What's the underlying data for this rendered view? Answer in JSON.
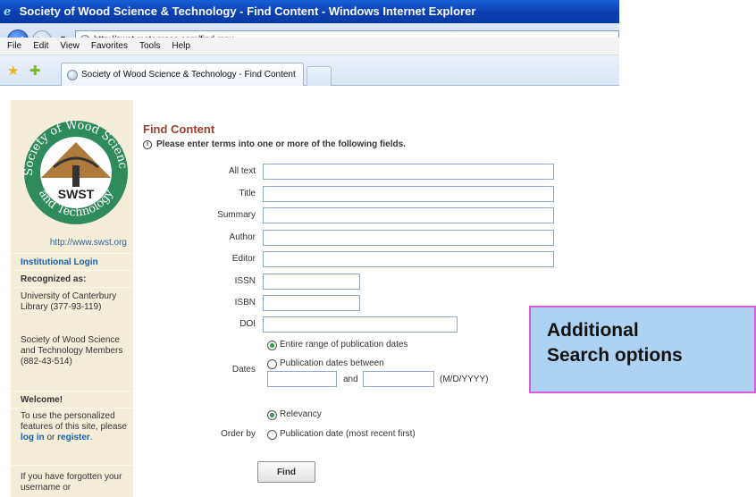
{
  "browser": {
    "window_title": "Society of Wood Science & Technology - Find Content - Windows Internet Explorer",
    "address": "http://swst.metapress.com/find.mpx",
    "menu": [
      "File",
      "Edit",
      "View",
      "Favorites",
      "Tools",
      "Help"
    ],
    "tab_label": "Society of Wood Science & Technology - Find Content",
    "back_glyph": "◀",
    "forward_glyph": "▶",
    "dropdown_glyph": "▼"
  },
  "sidebar": {
    "logo_text": "SWST",
    "logo_ring_top": "Society of Wood Science",
    "logo_ring_bottom": "and Technology",
    "site_url": "http://www.swst.org",
    "login_link": "Institutional Login",
    "recognized_head": "Recognized as:",
    "recognized_1": "University of Canterbury Library (377-93-119)",
    "recognized_2": "Society of Wood Science and Technology Members (882-43-514)",
    "welcome_head": "Welcome!",
    "welcome_pre": "To use the personalized features of this site, please",
    "log_in_link": "log in",
    "or_text": "or",
    "register_link": "register",
    "welcome_end": ".",
    "forgot_text": "If you have forgotten your username or"
  },
  "main": {
    "title": "Find Content",
    "info_icon": "i",
    "info_text": "Please enter terms into one or more of the following fields.",
    "fields": {
      "all_text": "All text",
      "title": "Title",
      "summary": "Summary",
      "author": "Author",
      "editor": "Editor",
      "issn": "ISSN",
      "isbn": "ISBN",
      "doi": "DOI"
    },
    "dates_label": "Dates",
    "dates_option_all": "Entire range of publication dates",
    "dates_option_between": "Publication dates between",
    "and_text": "and",
    "date_format": "(M/D/YYYY)",
    "orderby_label": "Order by",
    "order_option_relevancy": "Relevancy",
    "order_option_date": "Publication date (most recent first)",
    "find_button": "Find"
  },
  "callout": {
    "line1": "Additional",
    "line2": "Search options"
  },
  "colors": {
    "title_brown": "#a03d2c",
    "link_blue": "#1b5fa8",
    "callout_bg": "#aed3f2",
    "callout_border": "#e05ad8",
    "sidebar_bg": "#f4edd7"
  }
}
